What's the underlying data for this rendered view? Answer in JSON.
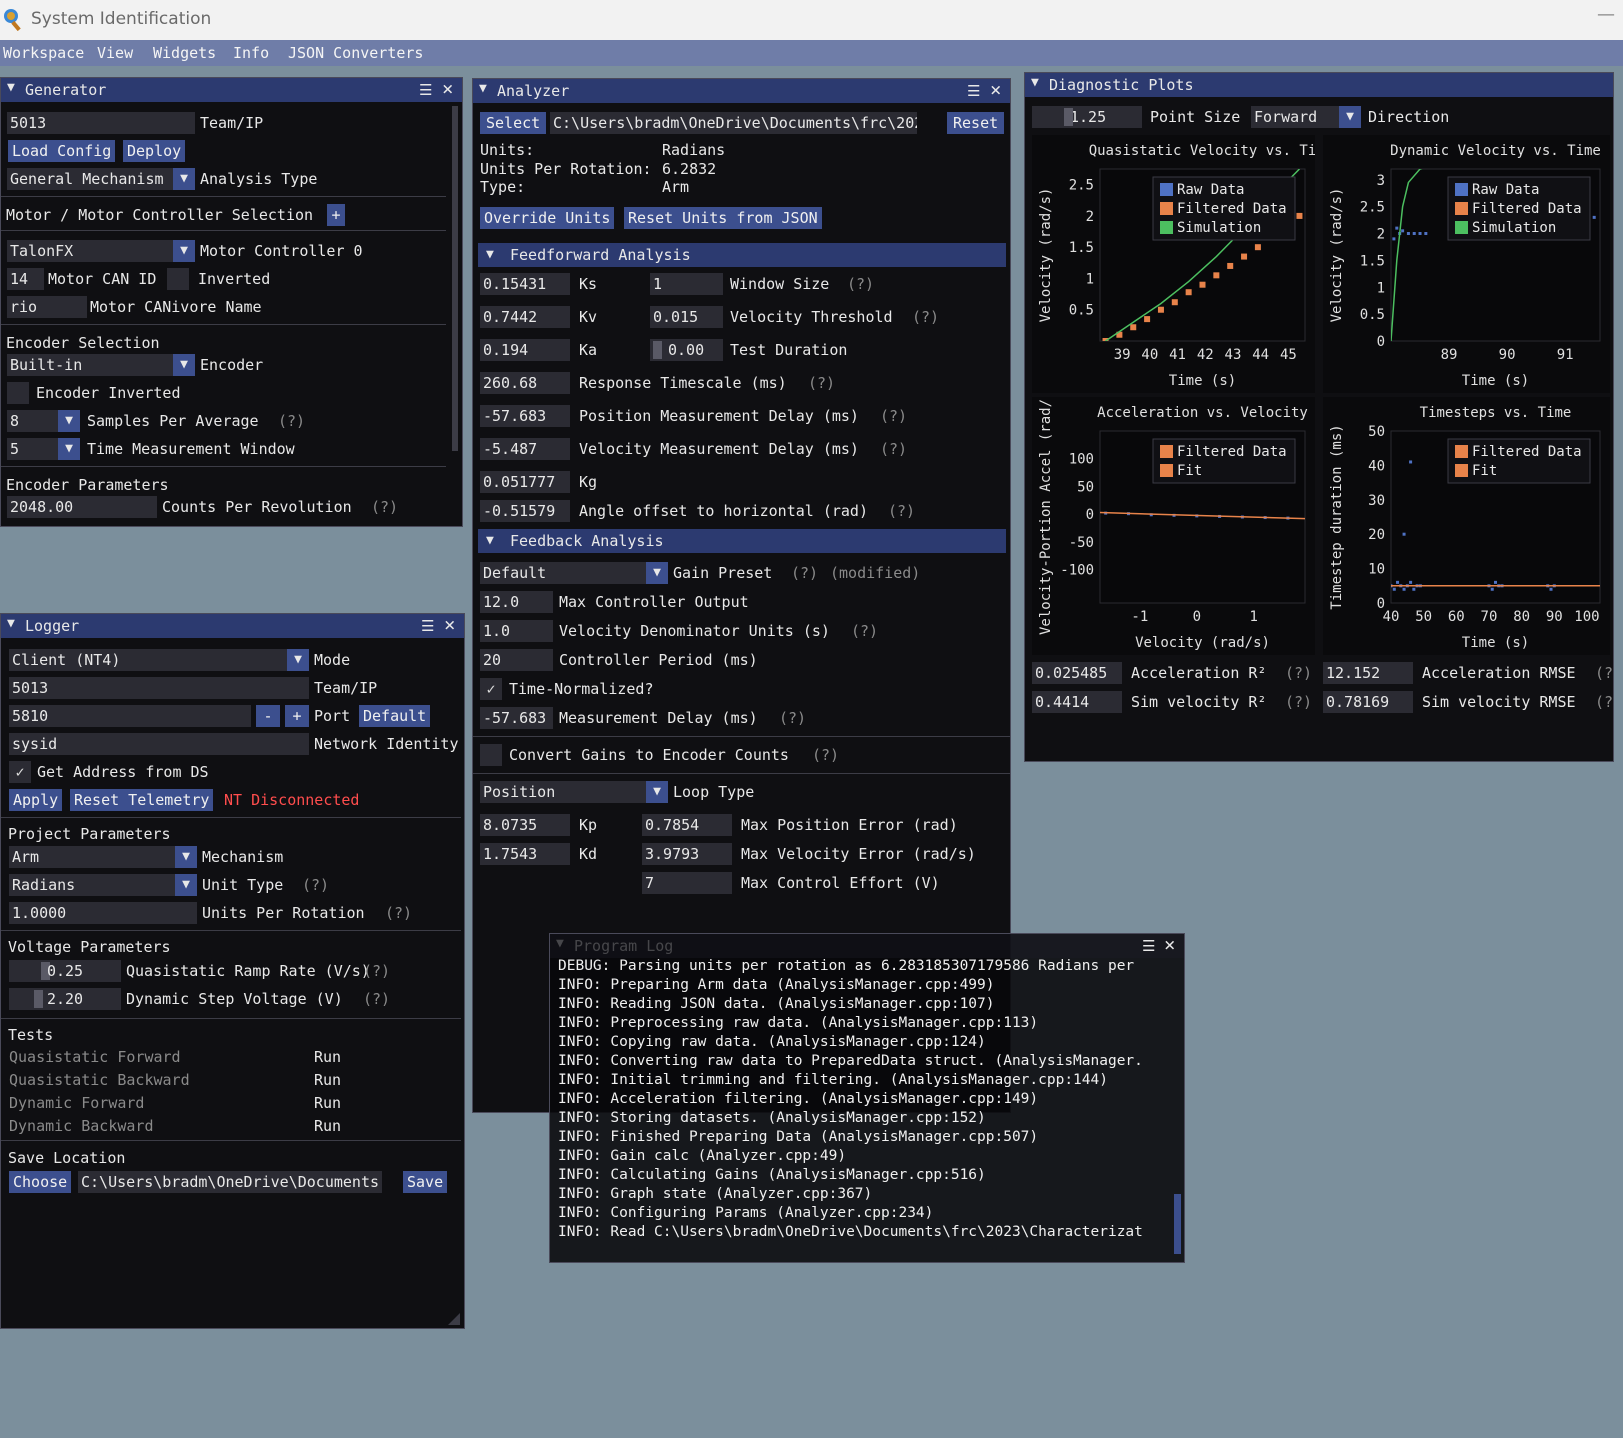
{
  "app": {
    "title": "System Identification"
  },
  "menu": [
    "Workspace",
    "View",
    "Widgets",
    "Info",
    "JSON Converters"
  ],
  "generator": {
    "title": "Generator",
    "team_ip_value": "5013",
    "team_ip_label": "Team/IP",
    "load_config": "Load Config",
    "deploy": "Deploy",
    "analysis_type_value": "General Mechanism",
    "analysis_type_label": "Analysis Type",
    "motor_section": "Motor / Motor Controller Selection",
    "add_symbol": "+",
    "controller_value": "TalonFX",
    "controller_label": "Motor Controller 0",
    "can_id_value": "14",
    "can_id_label": "Motor CAN ID",
    "inverted_label": "Inverted",
    "canivore_value": "rio",
    "canivore_label": "Motor CANivore Name",
    "encoder_section": "Encoder Selection",
    "encoder_value": "Built-in",
    "encoder_label": "Encoder",
    "encoder_inverted_label": "Encoder Inverted",
    "samples_value": "8",
    "samples_label": "Samples Per Average",
    "q": "(?)",
    "time_window_value": "5",
    "time_window_label": "Time Measurement Window",
    "encoder_params_section": "Encoder Parameters",
    "cpr_value": "2048.00",
    "cpr_label": "Counts Per Revolution"
  },
  "logger": {
    "title": "Logger",
    "mode_value": "Client (NT4)",
    "mode_label": "Mode",
    "team_ip_value": "5013",
    "team_ip_label": "Team/IP",
    "port_value": "5810",
    "minus": "-",
    "plus": "+",
    "port_label": "Port",
    "default_btn": "Default",
    "network_identity_value": "sysid",
    "network_identity_label": "Network Identity",
    "get_address_label": "Get Address from DS",
    "apply": "Apply",
    "reset_telemetry": "Reset Telemetry",
    "nt_status": "NT Disconnected",
    "project_section": "Project Parameters",
    "mechanism_value": "Arm",
    "mechanism_label": "Mechanism",
    "unit_type_value": "Radians",
    "unit_type_label": "Unit Type",
    "q": "(?)",
    "upr_value": "1.0000",
    "upr_label": "Units Per Rotation",
    "voltage_section": "Voltage Parameters",
    "ramp_value": "0.25",
    "ramp_label": "Quasistatic Ramp Rate (V/s)",
    "step_value": "2.20",
    "step_label": "Dynamic Step Voltage (V)",
    "tests_section": "Tests",
    "tests": [
      {
        "name": "Quasistatic Forward",
        "action": "Run"
      },
      {
        "name": "Quasistatic Backward",
        "action": "Run"
      },
      {
        "name": "Dynamic Forward",
        "action": "Run"
      },
      {
        "name": "Dynamic Backward",
        "action": "Run"
      }
    ],
    "save_section": "Save Location",
    "choose": "Choose",
    "save_path": "C:\\Users\\bradm\\OneDrive\\Documents",
    "save": "Save"
  },
  "analyzer": {
    "title": "Analyzer",
    "select": "Select",
    "path": "C:\\Users\\bradm\\OneDrive\\Documents\\frc\\202",
    "reset": "Reset",
    "units_label": "Units:",
    "units_value": "Radians",
    "upr_label": "Units Per Rotation:",
    "upr_value": "6.2832",
    "type_label": "Type:",
    "type_value": "Arm",
    "override_units": "Override Units",
    "reset_units": "Reset Units from JSON",
    "ff_section": "Feedforward Analysis",
    "ks_value": "0.15431",
    "ks_label": "Ks",
    "kv_value": "0.7442",
    "kv_label": "Kv",
    "ka_value": "0.194",
    "ka_label": "Ka",
    "window_size_value": "1",
    "window_size_label": "Window Size",
    "vel_thresh_value": "0.015",
    "vel_thresh_label": "Velocity Threshold",
    "test_duration_value": "0.00",
    "test_duration_label": "Test Duration",
    "response_value": "260.68",
    "response_label": "Response Timescale (ms)",
    "pos_delay_value": "-57.683",
    "pos_delay_label": "Position Measurement Delay (ms)",
    "vel_delay_value": "-5.487",
    "vel_delay_label": "Velocity Measurement Delay (ms)",
    "kg_value": "0.051777",
    "kg_label": "Kg",
    "angle_offset_value": "-0.51579",
    "angle_offset_label": "Angle offset to horizontal (rad)",
    "fb_section": "Feedback Analysis",
    "gain_preset_value": "Default",
    "gain_preset_label": "Gain Preset",
    "modified": "(modified)",
    "max_output_value": "12.0",
    "max_output_label": "Max Controller Output",
    "vel_denom_value": "1.0",
    "vel_denom_label": "Velocity Denominator Units (s)",
    "period_value": "20",
    "period_label": "Controller Period (ms)",
    "time_norm_label": "Time-Normalized?",
    "meas_delay_value": "-57.683",
    "meas_delay_label": "Measurement Delay (ms)",
    "convert_gains_label": "Convert Gains to Encoder Counts",
    "loop_type_value": "Position",
    "loop_type_label": "Loop Type",
    "kp_value": "8.0735",
    "kp_label": "Kp",
    "kd_value": "1.7543",
    "kd_label": "Kd",
    "max_pos_err_value": "0.7854",
    "max_pos_err_label": "Max Position Error (rad)",
    "max_vel_err_value": "3.9793",
    "max_vel_err_label": "Max Velocity Error (rad/s)",
    "max_effort_value": "7",
    "max_effort_label": "Max Control Effort (V)",
    "q": "(?)"
  },
  "diag": {
    "title": "Diagnostic Plots",
    "point_size_value": "1.25",
    "point_size_label": "Point Size",
    "direction_value": "Forward",
    "direction_label": "Direction",
    "acc_r2_value": "0.025485",
    "acc_r2_label": "Acceleration R²",
    "acc_rmse_value": "12.152",
    "acc_rmse_label": "Acceleration RMSE",
    "sim_r2_value": "0.4414",
    "sim_r2_label": "Sim velocity R²",
    "sim_rmse_value": "0.78169",
    "sim_rmse_label": "Sim velocity RMSE",
    "q": "(?)",
    "q_cut": "(?"
  },
  "chart_data": [
    {
      "type": "scatter",
      "title": "Quasistatic Velocity vs. Ti",
      "xlabel": "Time (s)",
      "ylabel": "Velocity (rad/s)",
      "xlim": [
        38.2,
        45.6
      ],
      "ylim": [
        0,
        2.75
      ],
      "xticks": [
        39,
        40,
        41,
        42,
        43,
        44,
        45
      ],
      "yticks": [
        0.5,
        1,
        1.5,
        2,
        2.5
      ],
      "legend": [
        "Raw Data",
        "Filtered Data",
        "Simulation"
      ],
      "legend_position": "top-right",
      "series": [
        {
          "name": "Filtered Data",
          "color": "#e8834a",
          "x": [
            38.4,
            38.9,
            39.4,
            39.9,
            40.4,
            40.9,
            41.4,
            41.9,
            42.4,
            42.9,
            43.4,
            43.9,
            44.4,
            44.9,
            45.4
          ],
          "y": [
            0.0,
            0.1,
            0.22,
            0.35,
            0.5,
            0.62,
            0.78,
            0.9,
            1.05,
            1.2,
            1.35,
            1.5,
            1.66,
            1.82,
            2.0
          ]
        },
        {
          "name": "Simulation",
          "color": "#4cbf60",
          "x": [
            38.4,
            39.4,
            40.4,
            41.4,
            42.4,
            43.4,
            44.4,
            45.4
          ],
          "y": [
            0.0,
            0.3,
            0.6,
            0.95,
            1.35,
            1.8,
            2.3,
            2.75
          ]
        }
      ]
    },
    {
      "type": "scatter",
      "title": "Dynamic Velocity vs. Time",
      "xlabel": "Time (s)",
      "ylabel": "Velocity (rad/s)",
      "xlim": [
        88.0,
        91.6
      ],
      "ylim": [
        0,
        3.2
      ],
      "xticks": [
        89,
        90,
        91
      ],
      "yticks": [
        0,
        0.5,
        1,
        1.5,
        2,
        2.5,
        3
      ],
      "legend": [
        "Raw Data",
        "Filtered Data",
        "Simulation"
      ],
      "legend_position": "top-right",
      "series": [
        {
          "name": "Raw Data",
          "color": "#4f72c4",
          "x": [
            88.05,
            88.1,
            88.15,
            88.2,
            88.3,
            88.4,
            88.5,
            88.6,
            91.4,
            91.5
          ],
          "y": [
            1.9,
            2.1,
            2.0,
            2.05,
            2.0,
            2.0,
            2.0,
            2.0,
            2.25,
            2.3
          ]
        },
        {
          "name": "Simulation",
          "color": "#4cbf60",
          "x": [
            88.0,
            88.1,
            88.2,
            88.3,
            88.5,
            88.8,
            89.2,
            89.8,
            90.4,
            91.0,
            91.6
          ],
          "y": [
            0.0,
            1.5,
            2.5,
            2.95,
            3.2,
            3.3,
            3.3,
            3.3,
            3.3,
            3.35,
            3.35
          ]
        }
      ]
    },
    {
      "type": "scatter",
      "title": "Acceleration vs. Velocity",
      "xlabel": "Velocity (rad/s)",
      "ylabel": "Velocity-Portion Accel (rad/",
      "xlim": [
        -1.7,
        1.9
      ],
      "ylim": [
        -160,
        150
      ],
      "xticks": [
        -1,
        0,
        1
      ],
      "yticks": [
        100,
        50,
        0,
        -50,
        -100
      ],
      "legend": [
        "Filtered Data",
        "Fit"
      ],
      "legend_position": "top-right",
      "series": [
        {
          "name": "Filtered Data",
          "color": "#4f72c4",
          "x": [
            -1.6,
            -1.2,
            -0.8,
            -0.4,
            0.0,
            0.4,
            0.8,
            1.2,
            1.6
          ],
          "y": [
            2,
            1,
            -1,
            -2,
            -3,
            -4,
            -5,
            -6,
            -7
          ]
        },
        {
          "name": "Fit",
          "color": "#e8834a",
          "x": [
            -1.7,
            1.9
          ],
          "y": [
            3,
            -8
          ]
        }
      ]
    },
    {
      "type": "scatter",
      "title": "Timesteps vs. Time",
      "xlabel": "Time (s)",
      "ylabel": "Timestep duration (ms)",
      "xlim": [
        40,
        104
      ],
      "ylim": [
        0,
        50
      ],
      "xticks": [
        40,
        50,
        60,
        70,
        80,
        90,
        100
      ],
      "yticks": [
        0,
        10,
        20,
        30,
        40,
        50
      ],
      "legend": [
        "Filtered Data",
        "Fit"
      ],
      "legend_position": "top-right",
      "series": [
        {
          "name": "Filtered Data",
          "color": "#4f72c4",
          "x": [
            40,
            41,
            42,
            43,
            44,
            45,
            46,
            47,
            48,
            49,
            46,
            44,
            70,
            71,
            72,
            73,
            74,
            88,
            89,
            90
          ],
          "y": [
            5,
            4,
            6,
            5,
            4,
            5,
            6,
            4,
            5,
            5,
            41,
            20,
            5,
            4,
            6,
            5,
            5,
            5,
            4,
            5
          ]
        },
        {
          "name": "Fit",
          "color": "#e8834a",
          "x": [
            40,
            104
          ],
          "y": [
            5,
            5
          ]
        }
      ]
    }
  ],
  "log": {
    "title": "Program Log",
    "lines": [
      "DEBUG: Parsing units per rotation as 6.283185307179586 Radians per",
      "INFO: Preparing Arm data (AnalysisManager.cpp:499)",
      "INFO: Reading JSON data. (AnalysisManager.cpp:107)",
      "INFO: Preprocessing raw data. (AnalysisManager.cpp:113)",
      "INFO: Copying raw data. (AnalysisManager.cpp:124)",
      "INFO: Converting raw data to PreparedData struct. (AnalysisManager.",
      "INFO: Initial trimming and filtering. (AnalysisManager.cpp:144)",
      "INFO: Acceleration filtering. (AnalysisManager.cpp:149)",
      "INFO: Storing datasets. (AnalysisManager.cpp:152)",
      "INFO: Finished Preparing Data (AnalysisManager.cpp:507)",
      "INFO: Gain calc (Analyzer.cpp:49)",
      "INFO: Calculating Gains (AnalysisManager.cpp:516)",
      "INFO: Graph state (Analyzer.cpp:367)",
      "INFO: Configuring Params (Analyzer.cpp:234)",
      "INFO: Read C:\\Users\\bradm\\OneDrive\\Documents\\frc\\2023\\Characterizat"
    ]
  },
  "colors": {
    "window_bg": "#0f0f12",
    "header_bg": "#2c3a70",
    "button_bg": "#3c4f8e",
    "field_bg": "#2b2b33",
    "desktop_bg": "#7b8f9c",
    "menubar_bg": "#6f7da8"
  }
}
